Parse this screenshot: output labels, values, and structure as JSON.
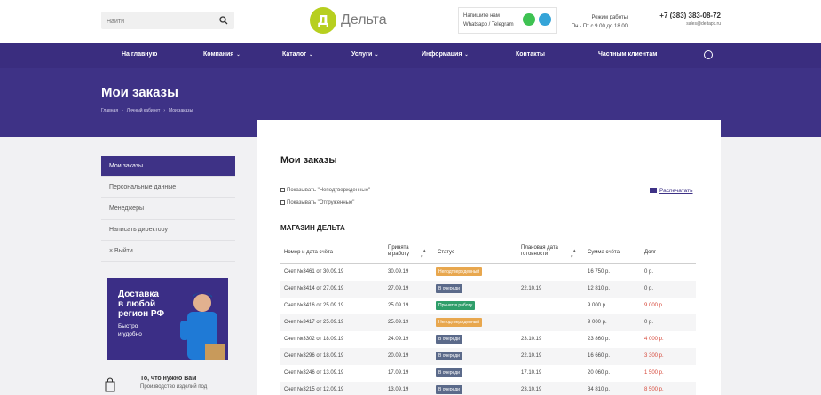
{
  "header": {
    "search_placeholder": "Найти",
    "logo_letter": "Д",
    "logo_text": "Дельта",
    "messenger_line1": "Напишите нам",
    "messenger_line2": "Whatsapp / Telegram",
    "hours_line1": "Режим работы",
    "hours_line2": "Пн - Пт с 9.00 до 18.00",
    "phone": "+7 (383) 383-08-72",
    "email": "sales@deltapk.ru"
  },
  "nav": {
    "items": [
      {
        "label": "На главную"
      },
      {
        "label": "Компания"
      },
      {
        "label": "Каталог"
      },
      {
        "label": "Услуги"
      },
      {
        "label": "Информация"
      },
      {
        "label": "Контакты"
      },
      {
        "label": "Частным клиентам"
      }
    ]
  },
  "banner": {
    "title": "Мои заказы",
    "crumbs": [
      "Главная",
      "Личный кабинет",
      "Мои заказы"
    ]
  },
  "sidebar": {
    "items": [
      {
        "label": "Мои заказы"
      },
      {
        "label": "Персональные данные"
      },
      {
        "label": "Менеджеры"
      },
      {
        "label": "Написать директору"
      },
      {
        "label": "Выйти"
      }
    ],
    "logout_icon": "×",
    "promo": {
      "line1": "Доставка",
      "line2": "в любой",
      "line3": "регион РФ",
      "sub1": "Быстро",
      "sub2": "и удобно"
    },
    "footer_title": "То, что нужно Вам",
    "footer_text": "Производство изделий под"
  },
  "main": {
    "title": "Мои заказы",
    "check1": "Показывать \"Неподтвержденные\"",
    "check2": "Показывать \"Отгруженные\"",
    "print_label": "Распечатать",
    "shop_title": "МАГАЗИН ДЕЛЬТА",
    "columns": {
      "invoice": "Номер и дата счёта",
      "accepted1": "Принята",
      "accepted2": "в работу",
      "status": "Статус",
      "planned1": "Плановая дата",
      "planned2": "готовности",
      "sum": "Сумма счёта",
      "debt": "Долг"
    },
    "rows": [
      {
        "invoice": "Счет №3461 от 30.09.19",
        "accepted": "30.09.19",
        "status": "Неподтвержденный",
        "planned": "",
        "sum": "16 750 р.",
        "debt": "0 р."
      },
      {
        "invoice": "Счет №3414 от 27.09.19",
        "accepted": "27.09.19",
        "status": "В очереди",
        "planned": "22.10.19",
        "sum": "12 810 р.",
        "debt": "0 р."
      },
      {
        "invoice": "Счет №3416 от 25.09.19",
        "accepted": "25.09.19",
        "status": "Принят в работу",
        "planned": "",
        "sum": "9 000 р.",
        "debt": "9 000 р."
      },
      {
        "invoice": "Счет №3417 от 25.09.19",
        "accepted": "25.09.19",
        "status": "Неподтвержденный",
        "planned": "",
        "sum": "9 000 р.",
        "debt": "0 р."
      },
      {
        "invoice": "Счет №3302 от 18.09.19",
        "accepted": "24.09.19",
        "status": "В очереди",
        "planned": "23.10.19",
        "sum": "23 860 р.",
        "debt": "4 000 р."
      },
      {
        "invoice": "Счет №3296 от 18.09.19",
        "accepted": "20.09.19",
        "status": "В очереди",
        "planned": "22.10.19",
        "sum": "16 660 р.",
        "debt": "3 300 р."
      },
      {
        "invoice": "Счет №3246 от 13.09.19",
        "accepted": "17.09.19",
        "status": "В очереди",
        "planned": "17.10.19",
        "sum": "20 060 р.",
        "debt": "1 500 р."
      },
      {
        "invoice": "Счет №3215 от 12.09.19",
        "accepted": "13.09.19",
        "status": "В очереди",
        "planned": "23.10.19",
        "sum": "34 810 р.",
        "debt": "8 500 р."
      }
    ]
  },
  "colors": {
    "brand": "#3e3286",
    "logo": "#b7cf1f",
    "status_unconfirmed": "#e8a74e",
    "status_queue": "#5b6a8a",
    "status_accepted": "#2f9e6a",
    "debt_red": "#d6483a"
  }
}
